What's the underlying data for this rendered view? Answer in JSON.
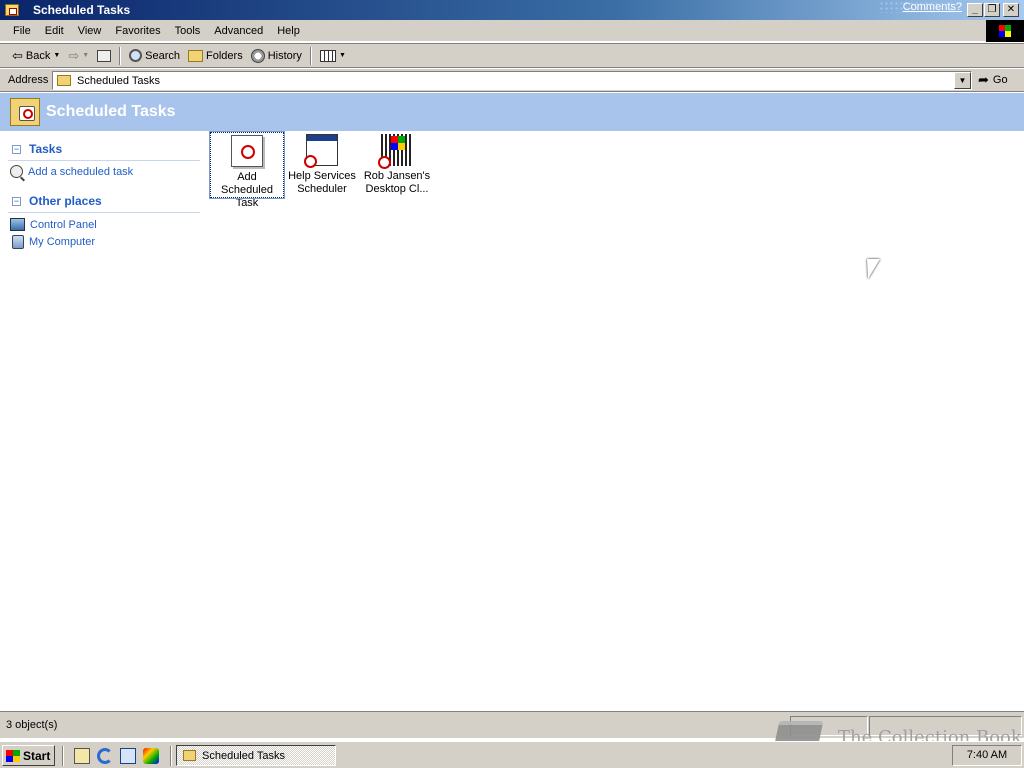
{
  "window": {
    "title": "Scheduled Tasks",
    "comments_link": "Comments?",
    "minimize": "_",
    "restore": "❐",
    "close": "✕"
  },
  "menu": [
    "File",
    "Edit",
    "View",
    "Favorites",
    "Tools",
    "Advanced",
    "Help"
  ],
  "toolbar": {
    "back": "Back",
    "search": "Search",
    "folders": "Folders",
    "history": "History"
  },
  "address": {
    "label": "Address",
    "value": "Scheduled Tasks",
    "go": "Go"
  },
  "banner": {
    "title": "Scheduled Tasks"
  },
  "tasks_pane": {
    "title": "Tasks",
    "links": [
      "Add a scheduled task"
    ]
  },
  "other_places": {
    "title": "Other places",
    "links": [
      "Control Panel",
      "My Computer"
    ]
  },
  "files": [
    {
      "label": "Add Scheduled Task",
      "icon": "add-scheduled-task-icon",
      "selected": true
    },
    {
      "label": "Help Services Scheduler",
      "icon": "help-services-scheduler-icon",
      "selected": false
    },
    {
      "label": "Rob Jansen's Desktop Cl...",
      "icon": "rob-jansen-task-icon",
      "selected": false
    }
  ],
  "status": {
    "text": "3 object(s)"
  },
  "watermark": {
    "text": "The Collection Book"
  },
  "taskbar": {
    "start": "Start",
    "task": "Scheduled Tasks",
    "clock": "7:40 AM"
  }
}
